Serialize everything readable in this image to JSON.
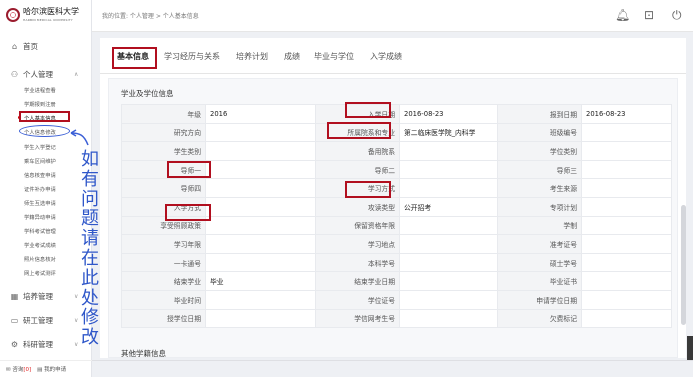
{
  "logo": {
    "text": "哈尔滨医科大学",
    "sub": "HARBIN MEDICAL UNIVERSITY"
  },
  "nav": {
    "home": "首页",
    "personal": "个人管理",
    "personal_items": [
      "学业进程查看",
      "学期报到注册",
      "个人基本信息",
      "个人信息修改",
      "学生入学登记",
      "乘车区间维护",
      "信息核查申请",
      "证件补办申请",
      "师生互选申请",
      "学籍异动申请",
      "学科考试管理",
      "学业考试成绩",
      "照片信息核对",
      "网上考试测评"
    ],
    "training": "培养管理",
    "research": "研工管理",
    "scientific": "科研管理",
    "icons": {
      "home": "home-icon",
      "personal": "user-icon",
      "training": "grid-icon",
      "research": "monitor-icon",
      "scientific": "gear-icon"
    }
  },
  "footer": {
    "consult": "咨询",
    "consult_count": "[0]",
    "mine": "我的申请"
  },
  "header": {
    "breadcrumb": "我的位置: 个人管理 > 个人基本信息",
    "icons": [
      "bell-icon",
      "lock-icon",
      "power-icon"
    ]
  },
  "tabs": [
    "基本信息",
    "学习经历与关系",
    "培养计划",
    "成绩",
    "毕业与学位",
    "入学成绩"
  ],
  "section": {
    "title": "学业及学位信息",
    "next_title": "其他学籍信息"
  },
  "table": [
    [
      "年级",
      "2016",
      "入学日期",
      "2016-08-23",
      "报到日期",
      "2016-08-23"
    ],
    [
      "研究方向",
      "",
      "所属院系和专业",
      "第二临床医学院_内科学",
      "班级编号",
      ""
    ],
    [
      "学生类别",
      "",
      "备用院系",
      "",
      "学位类别",
      ""
    ],
    [
      "导师一",
      "",
      "导师二",
      "",
      "导师三",
      ""
    ],
    [
      "导师四",
      "",
      "学习方式",
      "",
      "考生来源",
      ""
    ],
    [
      "入学方式",
      "",
      "攻读类型",
      "公开招考",
      "专项计划",
      ""
    ],
    [
      "享受照顾政策",
      "",
      "保留资格年限",
      "",
      "学制",
      ""
    ],
    [
      "学习年限",
      "",
      "学习地点",
      "",
      "准考证号",
      ""
    ],
    [
      "一卡通号",
      "",
      "本科学号",
      "",
      "硕士学号",
      ""
    ],
    [
      "结束学业",
      "毕业",
      "结束学业日期",
      "",
      "毕业证书",
      ""
    ],
    [
      "毕业时间",
      "",
      "学位证号",
      "",
      "申请学位日期",
      ""
    ],
    [
      "授学位日期",
      "",
      "学信网考生号",
      "",
      "欠费标记",
      ""
    ]
  ],
  "annotation": [
    "如",
    "有",
    "问",
    "题",
    "请",
    "在",
    "此",
    "处",
    "修",
    "改"
  ],
  "colors": {
    "accent_red": "#b10f1f",
    "annotation_blue": "#2f57c9"
  }
}
